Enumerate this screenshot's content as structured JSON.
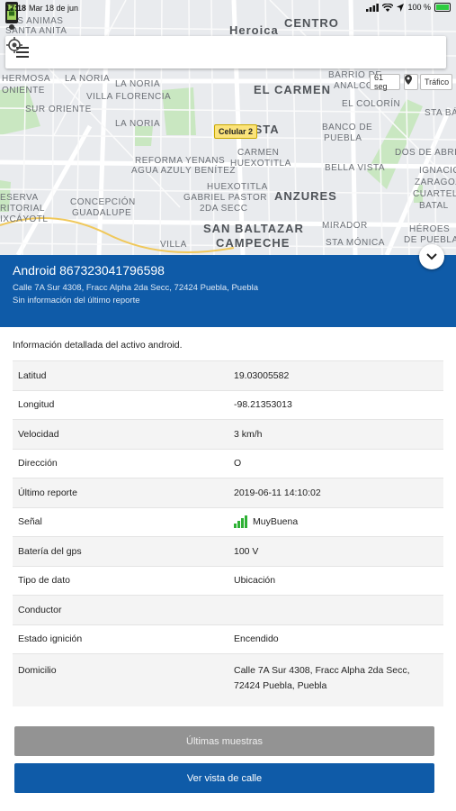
{
  "status_bar": {
    "time": "17:18",
    "date": "Mar 18 de jun",
    "battery": "100 %"
  },
  "map": {
    "labels": [
      "LAS ANIMAS",
      "SANTA ANITA",
      "HERMOSA",
      "ONIENTE",
      "LA NORIA",
      "LA NORIA",
      "VILLA FLORENCIA",
      "SUR ORIENTE",
      "LA NORIA",
      "REFORMA",
      "AGUA AZUL",
      "Y BENÍTEZ",
      "YENANS",
      "CARMEN",
      "HUEXOTITLA",
      "ESERVA",
      "RITORIAL",
      "IXCÁYOTL",
      "CONCEPCIÓN",
      "GUADALUPE",
      "HUEXOTITLA",
      "GABRIEL PASTOR",
      "2DA SECC",
      "VILLA",
      "BARRIO DE",
      "ANALCO",
      "EL COLORÍN",
      "STA BÁ",
      "BANCO DE",
      "PUEBLA",
      "BELLA VISTA",
      "DOS DE ABRIL",
      "IGNACIO",
      "ZARAGOZA",
      "CUARTEL",
      "BATAL",
      "MIRADOR",
      "HÉROES",
      "DE PUEBLA",
      "STA MÓNICA"
    ],
    "big_labels": [
      "Heroica",
      "CENTRO",
      "EL CARMEN",
      "ISTA",
      "ANZURES",
      "SAN BALTAZAR",
      "CAMPECHE"
    ],
    "interval_chip": "61 seg",
    "traffic_chip": "Tráfico",
    "marker_label": "Celular 2"
  },
  "asset": {
    "title": "Android 867323041796598",
    "address": "Calle 7A Sur 4308, Fracc Alpha 2da Secc, 72424 Puebla, Puebla",
    "last_report_note": "Sin información del último reporte"
  },
  "intro": "Información detallada del activo android.",
  "details": [
    {
      "key": "Latitud",
      "value": "19.03005582"
    },
    {
      "key": "Longitud",
      "value": "-98.21353013"
    },
    {
      "key": "Velocidad",
      "value": "3 km/h"
    },
    {
      "key": "Dirección",
      "value": "O"
    },
    {
      "key": "Último reporte",
      "value": "2019-06-11 14:10:02"
    },
    {
      "key": "Señal",
      "value": "MuyBuena"
    },
    {
      "key": "Batería del gps",
      "value": "100 V"
    },
    {
      "key": "Tipo de dato",
      "value": "Ubicación"
    },
    {
      "key": "Conductor",
      "value": ""
    },
    {
      "key": "Estado ignición",
      "value": "Encendido"
    },
    {
      "key": "Domicilio",
      "value": "Calle 7A Sur 4308, Fracc Alpha 2da Secc, 72424 Puebla, Puebla"
    }
  ],
  "buttons": {
    "samples": "Últimas muestras",
    "street_view": "Ver vista de calle"
  },
  "colors": {
    "primary": "#0f5ba8",
    "disabled": "#939393",
    "signal": "#2eb135",
    "marker": "#fbe37a"
  }
}
